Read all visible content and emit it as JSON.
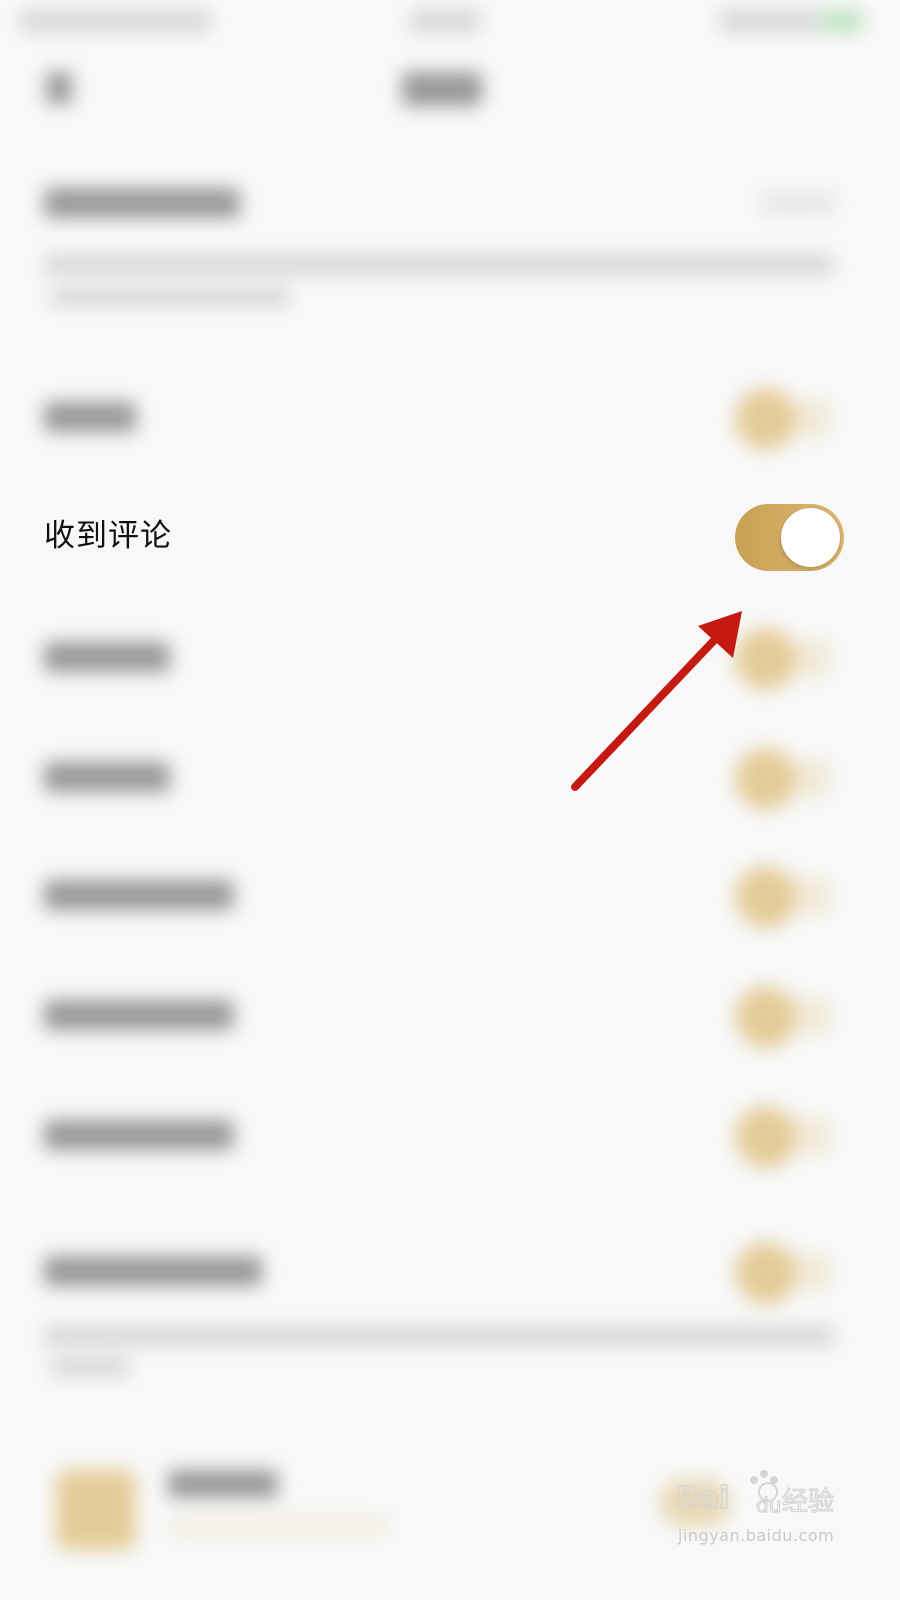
{
  "row": {
    "label": "收到评论",
    "toggle_state": "on"
  },
  "colors": {
    "toggle_on": "#d0aa5e",
    "arrow": "#c41a12",
    "background": "#f8f8f8"
  },
  "watermark": {
    "logo": "Bai du 经验",
    "url": "jingyan.baidu.com"
  }
}
